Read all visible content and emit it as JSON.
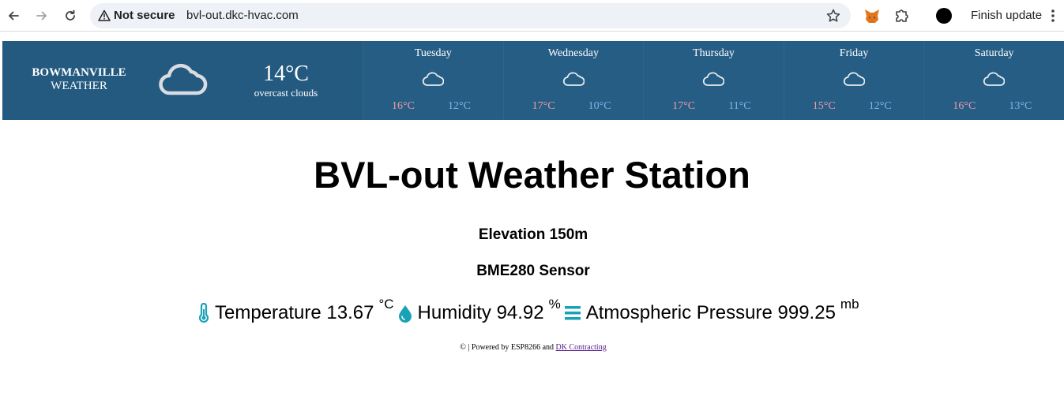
{
  "browser": {
    "security_label": "Not secure",
    "url": "bvl-out.dkc-hvac.com",
    "finish_update_label": "Finish update"
  },
  "banner": {
    "city_line1": "BOWMANVILLE",
    "city_line2": "WEATHER",
    "current_temp": "14°C",
    "current_desc": "overcast clouds",
    "current_icon": "cloud-icon",
    "colors": {
      "background": "#245a80",
      "high": "#ef9aa8",
      "low": "#7fb5ea"
    },
    "days": [
      {
        "name": "Tuesday",
        "high": "16°C",
        "low": "12°C",
        "icon": "cloud-icon"
      },
      {
        "name": "Wednesday",
        "high": "17°C",
        "low": "10°C",
        "icon": "cloud-icon"
      },
      {
        "name": "Thursday",
        "high": "17°C",
        "low": "11°C",
        "icon": "cloud-icon"
      },
      {
        "name": "Friday",
        "high": "15°C",
        "low": "12°C",
        "icon": "cloud-icon"
      },
      {
        "name": "Saturday",
        "high": "16°C",
        "low": "13°C",
        "icon": "cloud-icon"
      }
    ]
  },
  "main": {
    "title": "BVL-out Weather Station",
    "elevation": "Elevation 150m",
    "sensor": "BME280 Sensor",
    "readings": {
      "temperature_label": "Temperature 13.67",
      "temperature_unit": "°C",
      "humidity_label": "Humidity 94.92",
      "humidity_unit": "%",
      "pressure_label": "Atmospheric Pressure 999.25",
      "pressure_unit": "mb",
      "icon_color": "#17a2b8"
    },
    "footer": {
      "text": "© | Powered by ESP8266 and",
      "link_text": "DK Contracting"
    }
  }
}
